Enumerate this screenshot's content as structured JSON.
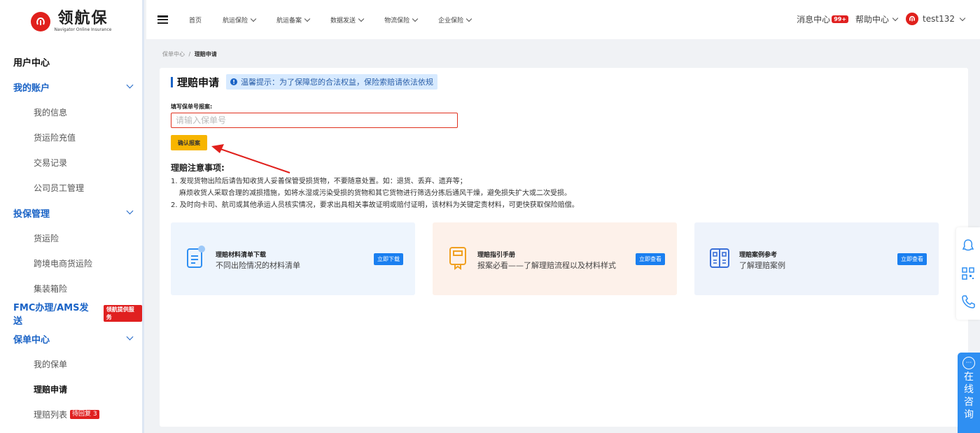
{
  "logo": {
    "mark": "ⓝ",
    "cn": "领航保",
    "en": "Navigator Online Insurance"
  },
  "sidebar": {
    "user_center": "用户中心",
    "my_account": "我的账户",
    "my_info": "我的信息",
    "recharge": "货运险充值",
    "transactions": "交易记录",
    "staff": "公司员工管理",
    "insure": "投保管理",
    "cargo": "货运险",
    "crossborder": "跨境电商货运险",
    "container": "集装箱险",
    "fmc": "FMC办理/AMS发送",
    "fmc_badge": "领航提供服务",
    "policy_center": "保单中心",
    "my_policy": "我的保单",
    "claim_apply": "理赔申请",
    "claim_list": "理赔列表",
    "claim_badge": "待回复 3"
  },
  "header": {
    "nav": [
      "首页",
      "航运保险",
      "航运备案",
      "数据发送",
      "物流保险",
      "企业保险"
    ],
    "messages": "消息中心",
    "msg_count": "99+",
    "help": "帮助中心",
    "user": "test132"
  },
  "breadcrumb": {
    "parent": "保单中心",
    "sep": "/",
    "current": "理赔申请"
  },
  "main": {
    "title": "理赔申请",
    "tip": "温馨提示：为了保障您的合法权益，保险索赔请依法依规",
    "field_label": "填写保单号报案:",
    "placeholder": "请输入保单号",
    "confirm": "确认报案",
    "notes_title": "理赔注意事项:",
    "note1": "1. 发现货物出险后请告知收货人妥善保管受损货物，不要随意处置。如：退货、丢弃、遗弃等；",
    "note1b": "麻烦收货人采取合理的减损措施，如将水湿或污染受损的货物和其它货物进行筛选分拣后通风干燥，避免损失扩大或二次受损。",
    "note2": "2. 及时向卡司、航司或其他承运人员核实情况，要求出具相关事故证明或赔付证明，该材料为关键定责材料，可更快获取保险赔偿。"
  },
  "cards": [
    {
      "title": "理赔材料清单下载",
      "desc": "不同出险情况的材料清单",
      "button": "立即下载"
    },
    {
      "title": "理赔指引手册",
      "desc": "报案必看——了解理赔流程以及材料样式",
      "button": "立即查看"
    },
    {
      "title": "理赔案例参考",
      "desc": "了解理赔案例",
      "button": "立即查看"
    }
  ],
  "chat": {
    "chars": [
      "在",
      "线",
      "咨",
      "询"
    ]
  },
  "colors": {
    "brand_blue": "#1a63c6",
    "accent_red": "#e0201c",
    "confirm_yellow": "#f7b500"
  }
}
